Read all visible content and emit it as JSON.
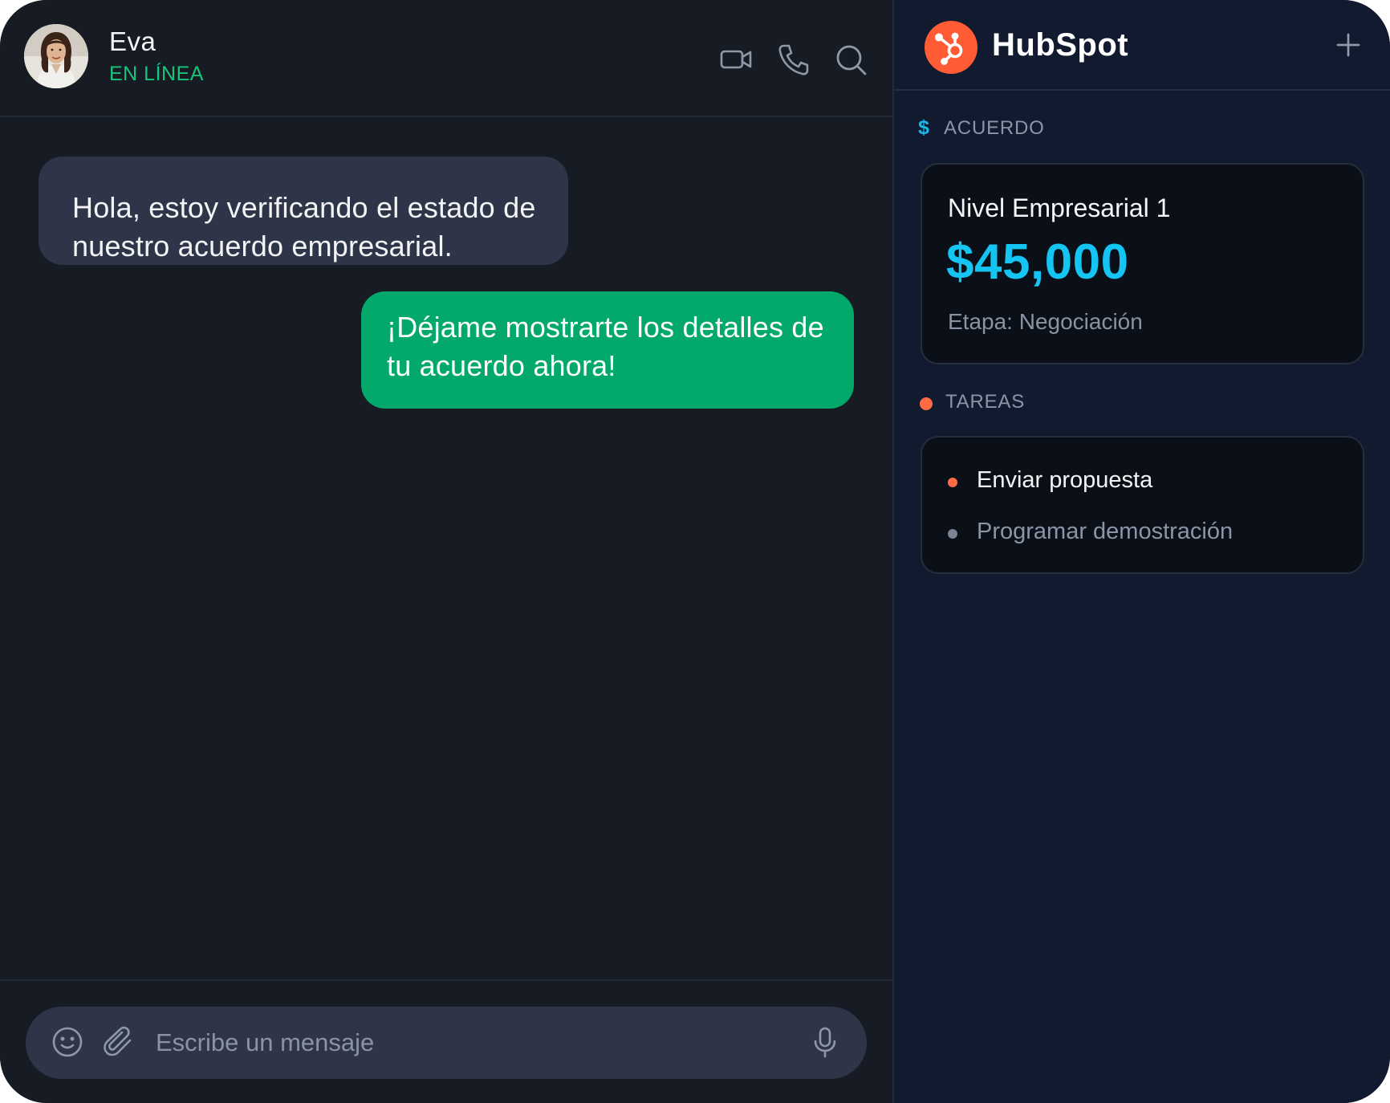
{
  "contact": {
    "name": "Eva",
    "status": "EN LÍNEA"
  },
  "header_icons": [
    "video-camera-icon",
    "phone-icon",
    "search-icon"
  ],
  "messages": [
    {
      "direction": "incoming",
      "text": "Hola, estoy verificando el estado de nuestro acuerdo empresarial."
    },
    {
      "direction": "outgoing",
      "text": "¡Déjame mostrarte los detalles de tu acuerdo ahora!"
    }
  ],
  "composer": {
    "placeholder": "Escribe un mensaje",
    "icons": [
      "emoji-icon",
      "paperclip-icon",
      "microphone-icon"
    ]
  },
  "crm": {
    "title": "HubSpot",
    "deal_section": {
      "icon": "$",
      "label": "ACUERDO"
    },
    "deal": {
      "name": "Nivel Empresarial 1",
      "amount": "$45,000",
      "stage": "Etapa: Negociación"
    },
    "tasks_section": {
      "label": "TAREAS"
    },
    "tasks": [
      {
        "label": "Enviar propuesta",
        "status": "pending"
      },
      {
        "label": "Programar demostración",
        "status": "upcoming"
      }
    ]
  },
  "colors": {
    "chat_bg": "#171c24",
    "crm_bg": "#111a2e",
    "incoming_bubble": "#2e3548",
    "outgoing_bubble": "#02a96a",
    "online": "#16c47a",
    "hubspot_orange": "#ff5c35",
    "deal_amount": "#14c4f2"
  }
}
